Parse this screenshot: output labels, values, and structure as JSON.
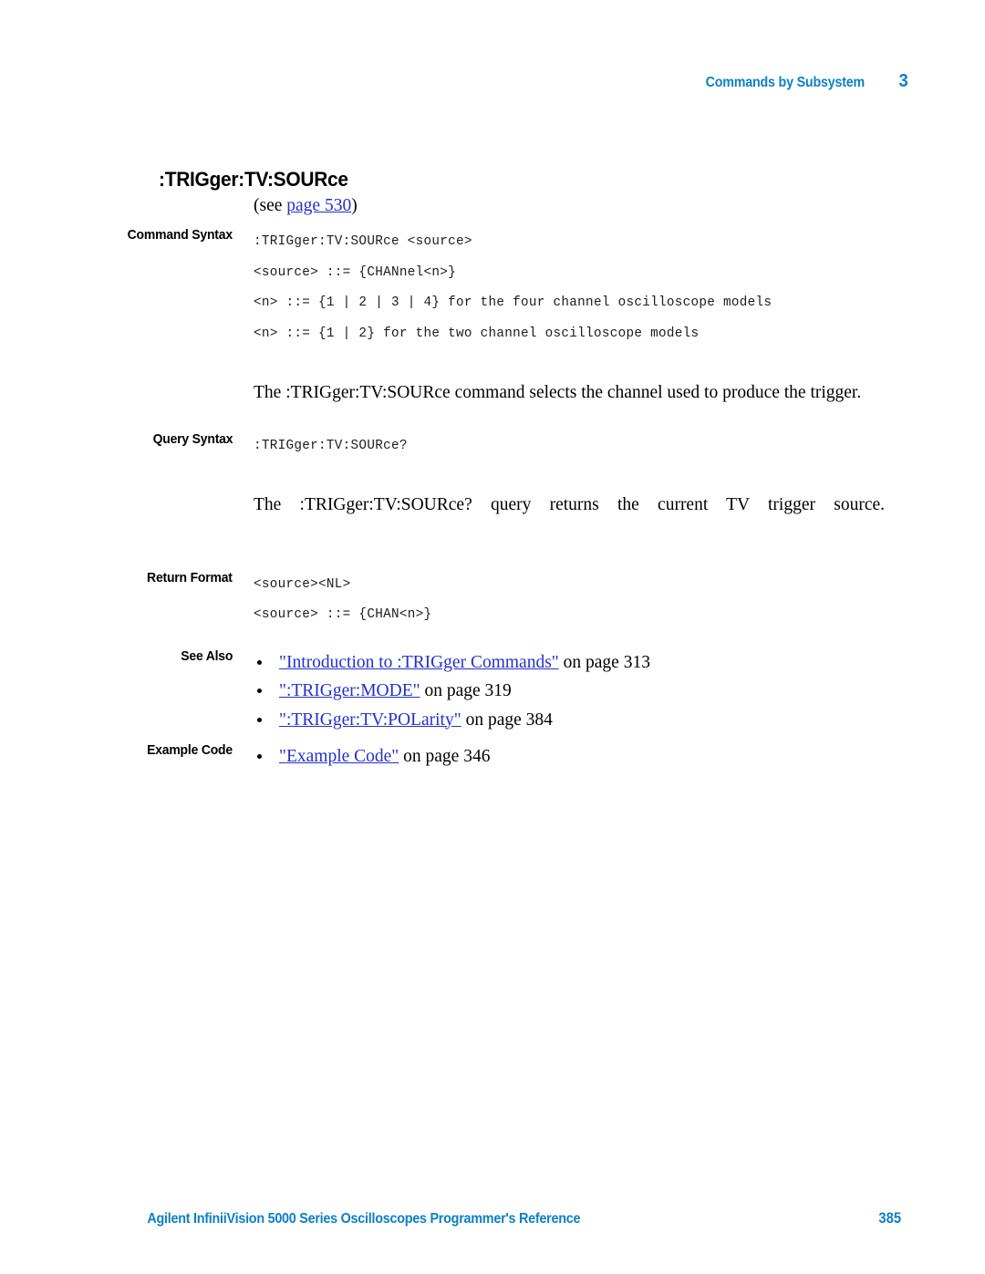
{
  "header": {
    "title": "Commands by Subsystem",
    "chapter": "3"
  },
  "command": {
    "title": ":TRIGger:TV:SOURce",
    "see_prefix": "(see ",
    "see_link": "page 530",
    "see_suffix": ")"
  },
  "sections": {
    "command_syntax_label": "Command Syntax",
    "query_syntax_label": "Query Syntax",
    "return_format_label": "Return Format",
    "see_also_label": "See Also",
    "example_code_label": "Example Code"
  },
  "command_syntax": {
    "line1": ":TRIGger:TV:SOURce <source>",
    "line2": "<source> ::= {CHANnel<n>}",
    "line3": "<n> ::= {1 | 2 | 3 | 4} for the four channel oscilloscope models",
    "line4": "<n> ::= {1 | 2} for the two channel oscilloscope models",
    "description": "The :TRIGger:TV:SOURce command selects the channel used to produce the trigger."
  },
  "query_syntax": {
    "line1": ":TRIGger:TV:SOURce?",
    "description": "The :TRIGger:TV:SOURce? query returns the current TV trigger source."
  },
  "return_format": {
    "line1": "<source><NL>",
    "line2": "<source> ::= {CHAN<n>}"
  },
  "see_also": [
    {
      "link": "\"Introduction to :TRIGger Commands\"",
      "suffix": " on page 313"
    },
    {
      "link": "\":TRIGger:MODE\"",
      "suffix": " on page 319"
    },
    {
      "link": "\":TRIGger:TV:POLarity\"",
      "suffix": " on page 384"
    }
  ],
  "example_code": [
    {
      "link": "\"Example Code\"",
      "suffix": " on page 346"
    }
  ],
  "footer": {
    "text": "Agilent InfiniiVision 5000 Series Oscilloscopes Programmer's Reference",
    "page_number": "385"
  },
  "colors": {
    "brand_blue": "#0d7fc4",
    "link_blue": "#2331c8",
    "text_black": "#000000"
  }
}
